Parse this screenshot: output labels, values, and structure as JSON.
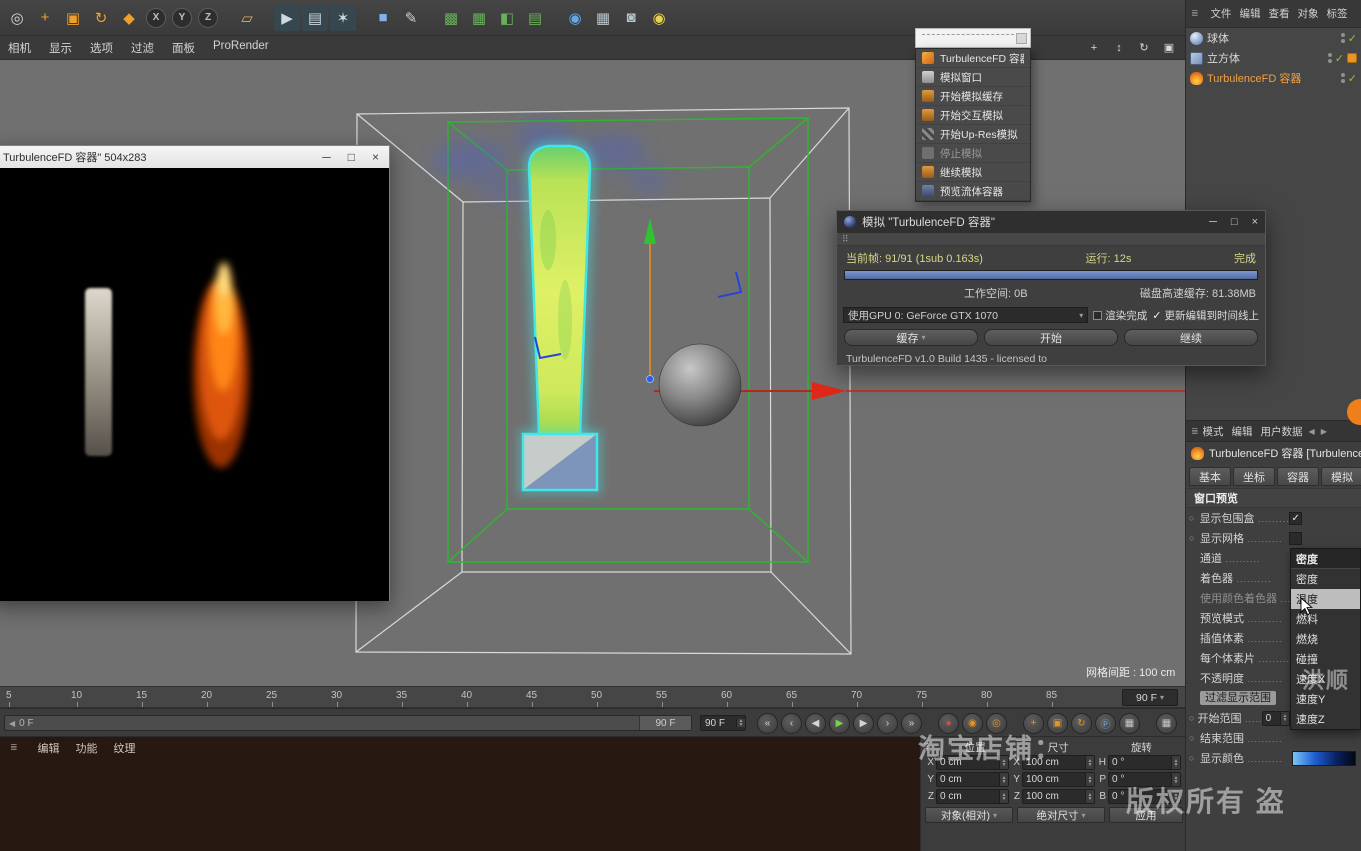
{
  "app": {
    "grid_spacing_label": "网格间距 : 100 cm"
  },
  "window_controls": {
    "minimize": "─",
    "maximize": "□",
    "close": "×"
  },
  "toolbar": {
    "icons": [
      {
        "name": "live-selection-icon",
        "glyph": "◎",
        "color": "#d8d8d8"
      },
      {
        "name": "move-tool-icon",
        "glyph": "+",
        "color": "#f0a028"
      },
      {
        "name": "scale-tool-icon",
        "glyph": "▣",
        "color": "#f0a028"
      },
      {
        "name": "rotate-tool-icon",
        "glyph": "↻",
        "color": "#f0a028"
      },
      {
        "name": "last-tool-icon",
        "glyph": "◆",
        "color": "#f0a028"
      },
      {
        "name": "lock-x-axis-button",
        "glyph": "X",
        "circle": true,
        "gap": true
      },
      {
        "name": "lock-y-axis-button",
        "glyph": "Y",
        "circle": true
      },
      {
        "name": "lock-z-axis-button",
        "glyph": "Z",
        "circle": true
      },
      {
        "name": "coordinate-system-button",
        "glyph": "▱",
        "color": "#e0b060",
        "gap": true
      },
      {
        "name": "render-view-button",
        "glyph": "▶",
        "color": "#cfd8dc",
        "bg": "#37474f",
        "gap": true
      },
      {
        "name": "render-picture-viewer-button",
        "glyph": "▤",
        "color": "#cfd8dc",
        "bg": "#37474f"
      },
      {
        "name": "render-settings-button",
        "glyph": "✶",
        "color": "#cfd8dc",
        "bg": "#37474f"
      },
      {
        "name": "primitive-cube-button",
        "glyph": "■",
        "color": "#7fb2e8",
        "gap": true
      },
      {
        "name": "pen-tool-button",
        "glyph": "✎",
        "color": "#cfcfcf"
      },
      {
        "name": "subdivision-surface-button",
        "glyph": "▩",
        "color": "#69b05a",
        "gap": true
      },
      {
        "name": "array-button",
        "glyph": "▦",
        "color": "#69b05a"
      },
      {
        "name": "boole-button",
        "glyph": "◧",
        "color": "#69b05a"
      },
      {
        "name": "volume-button",
        "glyph": "▤",
        "color": "#69b05a"
      },
      {
        "name": "field-button",
        "glyph": "◉",
        "color": "#64a8e8",
        "gap": true
      },
      {
        "name": "floor-button",
        "glyph": "▦",
        "color": "#b8c4cc"
      },
      {
        "name": "camera-button",
        "glyph": "◙",
        "color": "#b8c4cc"
      },
      {
        "name": "light-button",
        "glyph": "◉",
        "color": "#e8d44a"
      }
    ]
  },
  "viewport_menu": {
    "items": [
      "相机",
      "显示",
      "选项",
      "过滤",
      "面板",
      "ProRender"
    ],
    "nav_icons": [
      {
        "name": "pan-view-icon",
        "glyph": "+"
      },
      {
        "name": "zoom-view-icon",
        "glyph": "↕"
      },
      {
        "name": "rotate-view-icon",
        "glyph": "↻"
      },
      {
        "name": "maximize-view-icon",
        "glyph": "▣"
      }
    ]
  },
  "preview_window": {
    "title": "TurbulenceFD 容器\" 504x283"
  },
  "tfd_menu": {
    "items": [
      {
        "label": "TurbulenceFD 容器",
        "icon_bg": "linear-gradient(135deg,#f4b23c,#d2601a)"
      },
      {
        "label": "模拟窗口",
        "icon_bg": "linear-gradient(#cfcfcf,#8f8f8f)"
      },
      {
        "label": "开始模拟缓存",
        "icon_bg": "linear-gradient(#e09a40,#9a5a18)"
      },
      {
        "label": "开始交互模拟",
        "icon_bg": "linear-gradient(#e09a40,#9a5a18)"
      },
      {
        "label": "开始Up-Res模拟",
        "icon_bg": "repeating-linear-gradient(45deg,#888 0 3px,#444 3px 6px)"
      },
      {
        "label": "停止模拟",
        "disabled": true,
        "icon_bg": "#6f6f6f"
      },
      {
        "label": "继续模拟",
        "icon_bg": "linear-gradient(#e09a40,#9a5a18)"
      },
      {
        "label": "预览流体容器",
        "icon_bg": "linear-gradient(#6f82a8,#3a4a68)"
      }
    ]
  },
  "sim_dialog": {
    "title": "模拟 \"TurbulenceFD 容器\"",
    "frame_info": "当前帧: 91/91 (1sub 0.163s)",
    "runtime": "运行: 12s",
    "status": "完成",
    "workspace": "工作空间: 0B",
    "disk_cache": "磁盘高速缓存: 81.38MB",
    "device": "使用GPU 0: GeForce GTX 1070",
    "render_done_label": "渲染完成",
    "update_timeline_label": "更新编辑到时间线上",
    "cache_button": "缓存",
    "start_button": "开始",
    "continue_button": "继续",
    "license": "TurbulenceFD v1.0 Build 1435 - licensed to"
  },
  "ruler": {
    "marks": [
      5,
      10,
      15,
      20,
      25,
      30,
      35,
      40,
      45,
      50,
      55,
      60,
      65,
      70,
      75,
      80,
      85
    ],
    "end_frame": "90 F"
  },
  "transport": {
    "slider_min": "0 F",
    "slider_max": "90 F",
    "frame": "90 F",
    "buttons": [
      {
        "name": "go-to-start-button",
        "glyph": "«"
      },
      {
        "name": "previous-key-button",
        "glyph": "‹"
      },
      {
        "name": "previous-frame-button",
        "glyph": "◀"
      },
      {
        "name": "play-button",
        "glyph": "▶",
        "color": "#7ad24a"
      },
      {
        "name": "next-frame-button",
        "glyph": "▶"
      },
      {
        "name": "next-key-button",
        "glyph": "›"
      },
      {
        "name": "go-to-end-button",
        "glyph": "»"
      },
      {
        "name": "record-button",
        "glyph": "●",
        "color": "#e04838",
        "gap": true
      },
      {
        "name": "autokey-button",
        "glyph": "◉",
        "color": "#e8941e"
      },
      {
        "name": "keyframe-selection-button",
        "glyph": "◎",
        "color": "#e8941e"
      },
      {
        "name": "record-position-button",
        "glyph": "+",
        "color": "#e8941e",
        "gap": true
      },
      {
        "name": "record-scale-button",
        "glyph": "▣",
        "color": "#e8941e"
      },
      {
        "name": "record-rotation-button",
        "glyph": "↻",
        "color": "#e8941e"
      },
      {
        "name": "record-parameter-button",
        "glyph": "Ⓟ",
        "color": "#6fa8e8"
      },
      {
        "name": "pla-button",
        "glyph": "▦",
        "color": "#c8c8c8"
      },
      {
        "name": "layout-button",
        "glyph": "▦",
        "color": "#c8c8c8",
        "gap": true
      }
    ]
  },
  "bottom_menu": {
    "items": [
      "编辑",
      "功能",
      "纹理"
    ]
  },
  "coords": {
    "headers": [
      "位置",
      "尺寸",
      "旋转"
    ],
    "rows": [
      {
        "labels": [
          "X",
          "X",
          "H"
        ],
        "values": [
          "0 cm",
          "100 cm",
          "0 °"
        ]
      },
      {
        "labels": [
          "Y",
          "Y",
          "P"
        ],
        "values": [
          "0 cm",
          "100 cm",
          "0 °"
        ]
      },
      {
        "labels": [
          "Z",
          "Z",
          "B"
        ],
        "values": [
          "0 cm",
          "100 cm",
          "0 °"
        ]
      }
    ],
    "mode_dropdown": "对象(相对)",
    "size_dropdown": "绝对尺寸",
    "apply_button": "应用"
  },
  "object_manager": {
    "menu": [
      "文件",
      "编辑",
      "查看",
      "对象",
      "标签"
    ],
    "objects": [
      {
        "label": "球体",
        "icon": "sphere"
      },
      {
        "label": "立方体",
        "icon": "cube",
        "tag": true
      },
      {
        "label": "TurbulenceFD 容器",
        "icon": "fire",
        "highlight": true
      }
    ]
  },
  "attributes": {
    "menu": [
      "模式",
      "编辑",
      "用户数据"
    ],
    "object_title": "TurbulenceFD 容器 [TurbulenceFD...",
    "tabs": [
      "基本",
      "坐标",
      "容器",
      "模拟"
    ],
    "section": "窗口预览",
    "rows": [
      {
        "label": "显示包围盒",
        "anim": true,
        "value_type": "check",
        "checked": true
      },
      {
        "label": "显示网格",
        "anim": true,
        "value_type": "check",
        "checked": false
      },
      {
        "label": "通道",
        "value_type": "none"
      },
      {
        "label": "着色器",
        "value_type": "none"
      },
      {
        "label": "使用颜色着色器",
        "grayed": true,
        "value_type": "none"
      },
      {
        "label": "预览模式",
        "value_type": "none"
      },
      {
        "label": "插值体素",
        "value_type": "none"
      },
      {
        "label": "每个体素片",
        "value_type": "none"
      },
      {
        "label": "不透明度",
        "value_type": "none"
      },
      {
        "label": "过滤显示范围",
        "value_type": "chip"
      },
      {
        "label": "开始范围",
        "anim": true,
        "value_type": "field",
        "value": "0"
      },
      {
        "label": "结束范围",
        "anim": true,
        "value_type": "none"
      },
      {
        "label": "显示颜色",
        "anim": true,
        "value_type": "gradient"
      }
    ],
    "dropdown": {
      "current": "密度",
      "items": [
        {
          "label": "密度"
        },
        {
          "label": "温度",
          "hover": true
        },
        {
          "label": "燃料"
        },
        {
          "label": "燃烧"
        },
        {
          "label": "碰撞"
        },
        {
          "label": "速度X"
        },
        {
          "label": "速度Y"
        },
        {
          "label": "速度Z"
        }
      ]
    }
  },
  "watermarks": {
    "shop": "淘宝店铺：",
    "rights": "版权所有 盗",
    "name": "洪顺"
  },
  "colors": {
    "accent_orange": "#e8941e",
    "container_green": "#2cb82c",
    "selection_cyan": "#3fe8e8",
    "axis_red": "#e02818",
    "axis_green": "#2fc32f",
    "progress_blue": "#6a87c8",
    "check_green": "#7ec832"
  }
}
